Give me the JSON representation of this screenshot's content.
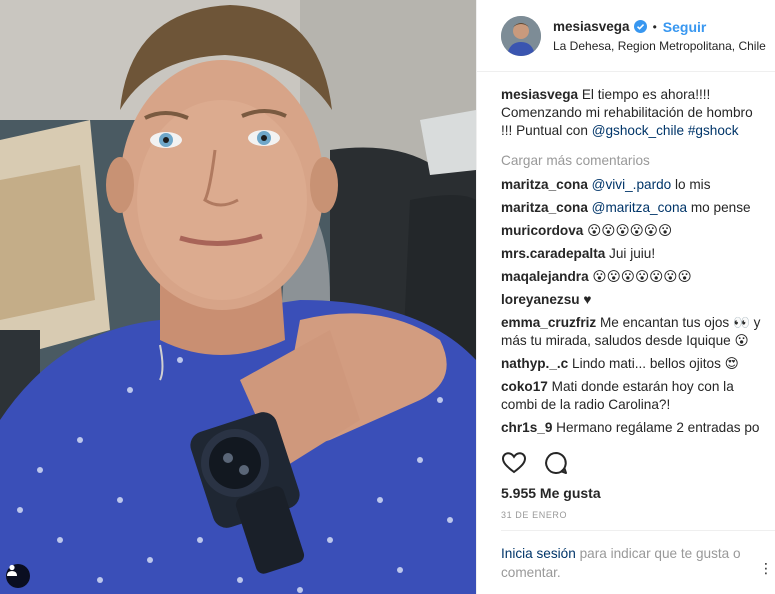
{
  "post": {
    "username": "mesiasvega",
    "dot": "•",
    "follow_label": "Seguir",
    "location": "La Dehesa, Region Metropolitana, Chile"
  },
  "caption": {
    "user": "mesiasvega",
    "text_before": " El tiempo es ahora!!!! Comenzando mi rehabilitación de hombro !!! Puntual con ",
    "mention": "@gshock_chile",
    "space": " ",
    "hashtag": "#gshock"
  },
  "load_more": "Cargar más comentarios",
  "comments": [
    {
      "user": "maritza_cona",
      "mention": "@vivi_.pardo",
      "text": " lo mis"
    },
    {
      "user": "maritza_cona",
      "mention": "@maritza_cona",
      "text": " mo pense"
    },
    {
      "user": "muricordova",
      "mention": "",
      "text": " 😮😮😮😮😮😮"
    },
    {
      "user": "mrs.caradepalta",
      "mention": "",
      "text": " Jui juiu!"
    },
    {
      "user": "maqalejandra",
      "mention": "",
      "text": " 😮😮😮😮😮😮😮"
    },
    {
      "user": "loreyanezsu",
      "mention": "",
      "text": " ♥"
    },
    {
      "user": "emma_cruzfriz",
      "mention": "",
      "text": " Me encantan tus ojos 👀 y más tu mirada, saludos desde Iquique 😮"
    },
    {
      "user": "nathyp._.c",
      "mention": "",
      "text": " Lindo mati... bellos ojitos 😍"
    },
    {
      "user": "coko17",
      "mention": "",
      "text": " Mati donde estarán hoy con la combi de la radio Carolina?!"
    },
    {
      "user": "chr1s_9",
      "mention": "",
      "text": " Hermano regálame 2 entradas po"
    }
  ],
  "likes": "5.955 Me gusta",
  "date": "31 DE ENERO",
  "login": {
    "link": "Inicia sesión",
    "text": " para indicar que te gusta o comentar."
  },
  "more_icon": "⋮",
  "icons": {
    "heart": "heart-icon",
    "comment": "comment-icon",
    "verified": "verified-badge-icon",
    "tag": "user-tag-icon"
  },
  "colors": {
    "link_blue": "#3897f0",
    "mention_blue": "#003569",
    "muted": "#999999",
    "text": "#262626",
    "divider": "#efefef"
  }
}
